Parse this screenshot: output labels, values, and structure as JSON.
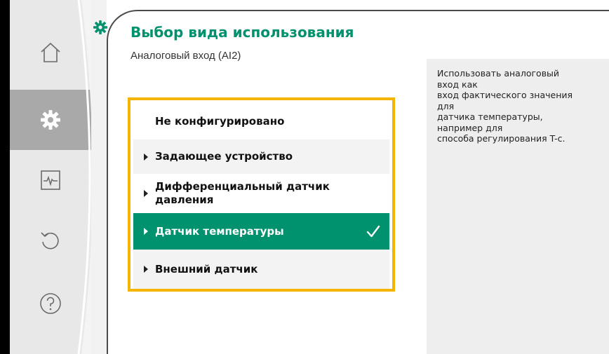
{
  "header": {
    "title": "Выбор вида использования",
    "subtitle": "Аналоговый вход (AI2)"
  },
  "sidebar": {
    "items": [
      {
        "icon": "home-icon",
        "active": false
      },
      {
        "icon": "gear-icon",
        "active": true
      },
      {
        "icon": "monitor-icon",
        "active": false
      },
      {
        "icon": "undo-icon",
        "active": false
      },
      {
        "icon": "help-icon",
        "active": false
      }
    ]
  },
  "options": [
    {
      "label": "Не конфигурировано",
      "has_arrow": false,
      "selected": false
    },
    {
      "label": "Задающее устройство",
      "has_arrow": true,
      "selected": false
    },
    {
      "label": "Дифференциальный датчик давления",
      "has_arrow": true,
      "selected": false
    },
    {
      "label": "Датчик температуры",
      "has_arrow": true,
      "selected": true
    },
    {
      "label": "Внешний датчик",
      "has_arrow": true,
      "selected": false
    }
  ],
  "info": {
    "text": "Использовать аналоговый\nвход как\nвход фактического значения\nдля\nдатчика температуры,\nнапример для\nспособа регулирования T-c."
  },
  "colors": {
    "accent": "#00916e",
    "focus_border": "#f5b400",
    "sidebar_bg": "#e8e8e8",
    "sidebar_active": "#a9a9a9"
  }
}
